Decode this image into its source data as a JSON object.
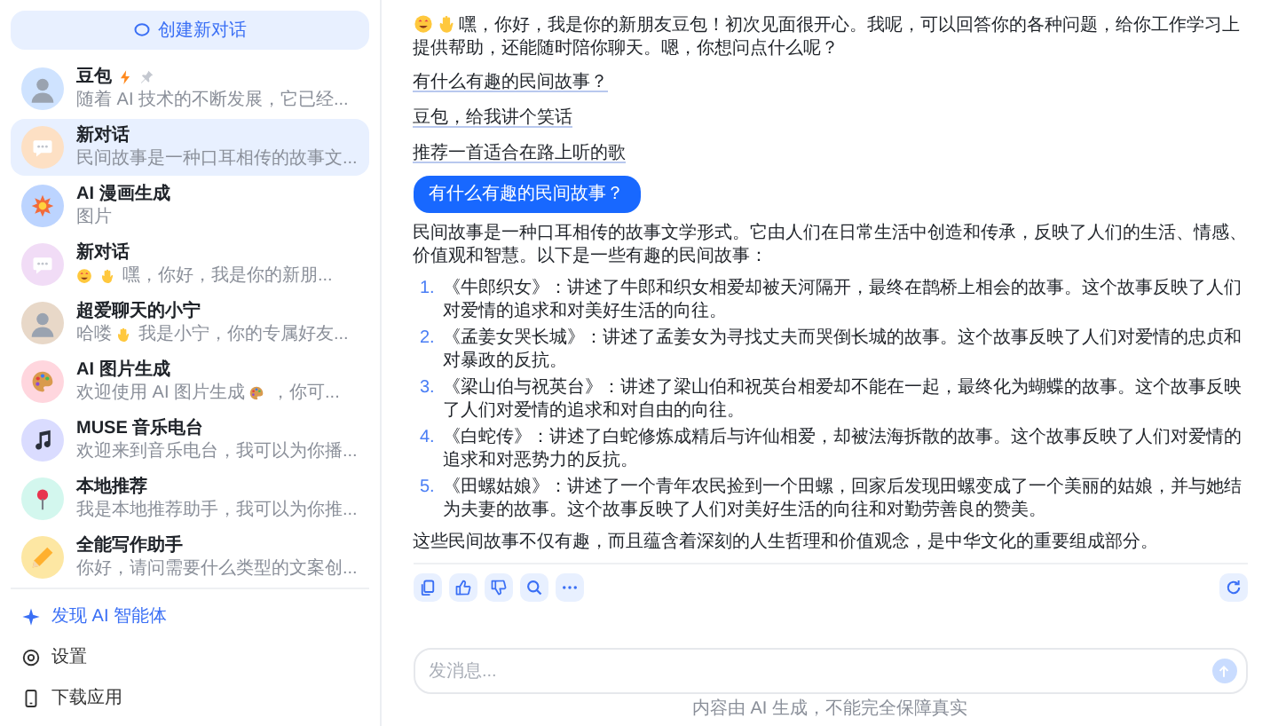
{
  "sidebar": {
    "new_chat": "创建新对话",
    "items": [
      {
        "title": "豆包",
        "title_icons": [
          {
            "kind": "lightning"
          },
          {
            "kind": "pin"
          }
        ],
        "kind": "photo",
        "color": "#cfe3ff",
        "selected": false,
        "preview": [
          {
            "kind": "text",
            "text": "随着 AI 技术的不断发展，它已经..."
          }
        ]
      },
      {
        "title": "新对话",
        "kind": "chat",
        "color": "#fde0c4",
        "selected": true,
        "preview": [
          {
            "kind": "text",
            "text": "民间故事是一种口耳相传的故事文..."
          }
        ]
      },
      {
        "title": "AI 漫画生成",
        "kind": "burst",
        "color": "#bcd4ff",
        "selected": false,
        "preview": [
          {
            "kind": "text",
            "text": "图片"
          }
        ]
      },
      {
        "title": "新对话",
        "kind": "chat",
        "color": "#f1dcf6",
        "selected": false,
        "preview": [
          {
            "kind": "grin"
          },
          {
            "kind": "wave"
          },
          {
            "kind": "text",
            "text": "嘿，你好，我是你的新朋..."
          }
        ]
      },
      {
        "title": "超爱聊天的小宁",
        "kind": "photo",
        "color": "#e8d8c8",
        "selected": false,
        "preview": [
          {
            "kind": "text",
            "text": "哈喽"
          },
          {
            "kind": "wave"
          },
          {
            "kind": "text",
            "text": "我是小宁，你的专属好友..."
          }
        ]
      },
      {
        "title": "AI 图片生成",
        "kind": "palette",
        "color": "#ffd6de",
        "selected": false,
        "preview": [
          {
            "kind": "text",
            "text": "欢迎使用 AI 图片生成"
          },
          {
            "kind": "palette"
          },
          {
            "kind": "text",
            "text": "，你可..."
          }
        ]
      },
      {
        "title": "MUSE 音乐电台",
        "kind": "note",
        "color": "#dadcff",
        "selected": false,
        "preview": [
          {
            "kind": "text",
            "text": "欢迎来到音乐电台，我可以为你播..."
          }
        ]
      },
      {
        "title": "本地推荐",
        "kind": "pin",
        "color": "#d3f7ee",
        "selected": false,
        "preview": [
          {
            "kind": "text",
            "text": "我是本地推荐助手，我可以为你推..."
          }
        ]
      },
      {
        "title": "全能写作助手",
        "kind": "pencil",
        "color": "#fde7a3",
        "selected": false,
        "preview": [
          {
            "kind": "text",
            "text": "你好，请问需要什么类型的文案创..."
          }
        ]
      }
    ],
    "footer": [
      {
        "kind": "sparkle",
        "label": "发现 AI 智能体"
      },
      {
        "kind": "gear",
        "label": "设置"
      },
      {
        "kind": "phone",
        "label": "下载应用"
      }
    ]
  },
  "chat": {
    "greeting": [
      {
        "kind": "grin"
      },
      {
        "kind": "wave"
      },
      {
        "kind": "text",
        "text": "嘿，你好，我是你的新朋友豆包！初次见面很开心。我呢，可以回答你的各种问题，给你工作学习上提供帮助，还能随时陪你聊天。嗯，你想问点什么呢？"
      }
    ],
    "suggestions": [
      "有什么有趣的民间故事？",
      "豆包，给我讲个笑话",
      "推荐一首适合在路上听的歌"
    ],
    "user_message": "有什么有趣的民间故事？",
    "answer": {
      "intro": "民间故事是一种口耳相传的故事文学形式。它由人们在日常生活中创造和传承，反映了人们的生活、情感、价值观和智慧。以下是一些有趣的民间故事：",
      "items": [
        {
          "number": "1.",
          "text": "《牛郎织女》：讲述了牛郎和织女相爱却被天河隔开，最终在鹊桥上相会的故事。这个故事反映了人们对爱情的追求和对美好生活的向往。"
        },
        {
          "number": "2.",
          "text": "《孟姜女哭长城》：讲述了孟姜女为寻找丈夫而哭倒长城的故事。这个故事反映了人们对爱情的忠贞和对暴政的反抗。"
        },
        {
          "number": "3.",
          "text": "《梁山伯与祝英台》：讲述了梁山伯和祝英台相爱却不能在一起，最终化为蝴蝶的故事。这个故事反映了人们对爱情的追求和对自由的向往。"
        },
        {
          "number": "4.",
          "text": "《白蛇传》：讲述了白蛇修炼成精后与许仙相爱，却被法海拆散的故事。这个故事反映了人们对爱情的追求和对恶势力的反抗。"
        },
        {
          "number": "5.",
          "text": "《田螺姑娘》：讲述了一个青年农民捡到一个田螺，回家后发现田螺变成了一个美丽的姑娘，并与她结为夫妻的故事。这个故事反映了人们对美好生活的向往和对勤劳善良的赞美。"
        }
      ],
      "conclusion": "这些民间故事不仅有趣，而且蕴含着深刻的人生哲理和价值观念，是中华文化的重要组成部分。"
    },
    "actions": [
      {
        "kind": "copy"
      },
      {
        "kind": "like"
      },
      {
        "kind": "dislike"
      },
      {
        "kind": "search"
      },
      {
        "kind": "more"
      }
    ],
    "regenerate": {
      "kind": "refresh"
    },
    "input": {
      "placeholder": "发消息...",
      "send_disabled": true
    },
    "footer_note": "内容由 AI 生成，不能完全保障真实"
  }
}
